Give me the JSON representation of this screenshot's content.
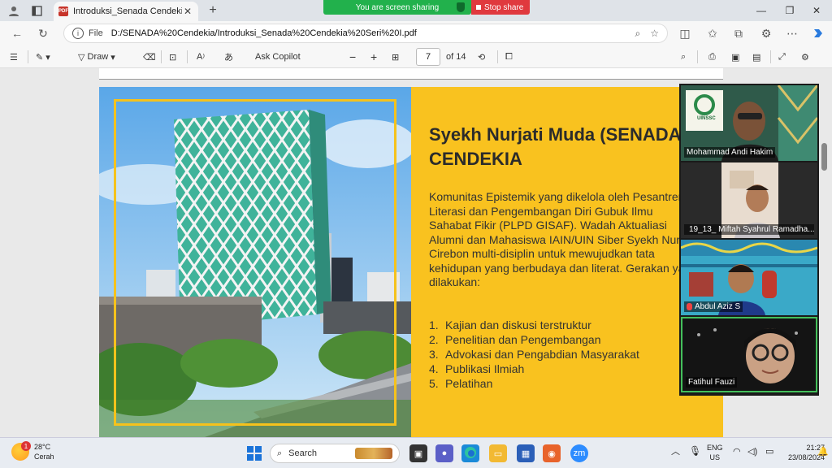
{
  "browser": {
    "tab_title": "Introduksi_Senada Cendekia Seri",
    "tab_close": "✕",
    "new_tab": "+",
    "share_banner": "You are screen sharing",
    "stop_share": "Stop share",
    "address_scheme": "File",
    "url": "D:/SENADA%20Cendekia/Introduksi_Senada%20Cendekia%20Seri%20I.pdf"
  },
  "pdf_toolbar": {
    "draw_label": "Draw",
    "copilot_label": "Ask Copilot",
    "aa_label": "A",
    "translate_label": "あ",
    "current_page": "7",
    "total_pages": "of 14"
  },
  "slide": {
    "title": "Syekh Nurjati Muda (SENADA) CENDEKIA",
    "paragraph": "Komunitas Epistemik yang dikelola oleh Pesantren Literasi dan Pengembangan Diri Gubuk Ilmu Sahabat Fikir (PLPD GISAF). Wadah Aktualiasi Alumni dan Mahasiswa IAIN/UIN Siber Syekh Nurjati Cirebon  multi-disiplin untuk mewujudkan tata kehidupan yang berbudaya dan literat. Gerakan yang dilakukan:",
    "list": [
      {
        "num": "1.",
        "text": "Kajian dan diskusi terstruktur"
      },
      {
        "num": "2.",
        "text": "Penelitian dan Pengembangan"
      },
      {
        "num": "3.",
        "text": "Advokasi dan Pengabdian Masyarakat"
      },
      {
        "num": "4.",
        "text": "Publikasi Ilmiah"
      },
      {
        "num": "5.",
        "text": "Pelatihan"
      }
    ]
  },
  "zoom": {
    "participants": [
      {
        "name": "Mohammad Andi Hakim",
        "muted": false
      },
      {
        "name": "19_13_ Miftah Syahrul Ramadha...",
        "muted": true
      },
      {
        "name": "Abdul Aziz S",
        "muted": true
      },
      {
        "name": "Fatihul Fauzi",
        "muted": false
      }
    ],
    "logo_text": "UINSSC"
  },
  "taskbar": {
    "weather_temp": "28°C",
    "weather_desc": "Cerah",
    "weather_badge": "1",
    "search_label": "Search",
    "lang": "ENG",
    "region": "US",
    "time": "21:27",
    "date": "23/08/2024"
  },
  "colors": {
    "slide_yellow": "#f9c21f",
    "share_green": "#22b14c",
    "stop_red": "#e0393e"
  }
}
